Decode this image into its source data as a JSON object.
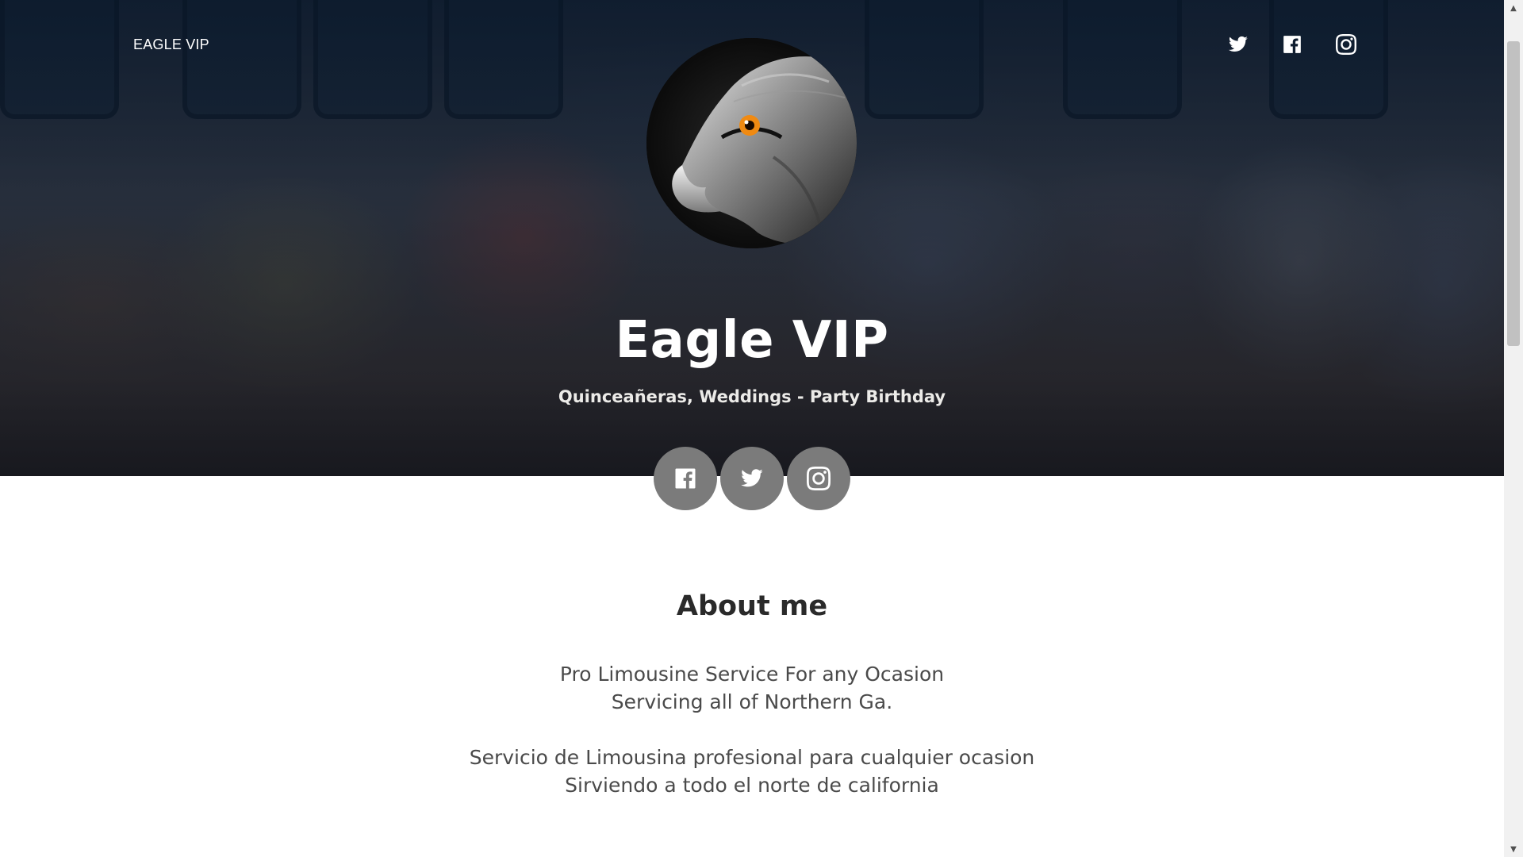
{
  "header": {
    "brand": "EAGLE VIP",
    "social_icons": [
      "twitter-icon",
      "facebook-icon",
      "instagram-icon"
    ]
  },
  "hero": {
    "title": "Eagle VIP",
    "subtitle": "Quinceañeras, Weddings - Party Birthday",
    "avatar_icon": "eagle-head"
  },
  "social_circles": {
    "icons": [
      "facebook-icon",
      "twitter-icon",
      "instagram-icon"
    ],
    "background": "#7b7b7b"
  },
  "about": {
    "title": "About me",
    "lines": [
      "Pro Limousine Service For any Ocasion",
      "Servicing all of Northern Ga.",
      "Servicio de Limousina profesional para cualquier ocasion",
      "Sirviendo a todo el norte de california"
    ]
  },
  "colors": {
    "overlay": "#0c1a2c",
    "heading_text": "#2a2a2a",
    "body_text": "#4a4a4a",
    "eagle_eye": "#f08a12"
  }
}
